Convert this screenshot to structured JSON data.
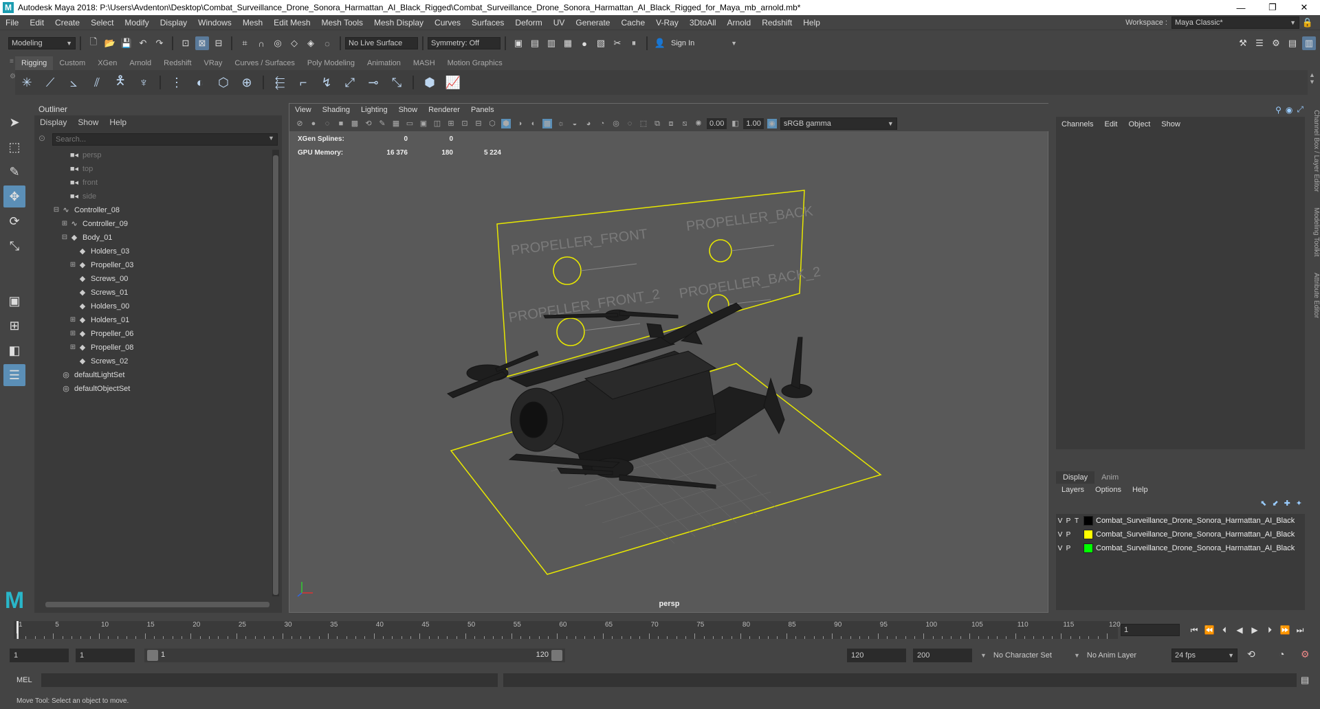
{
  "title_bar": {
    "title": "Autodesk Maya 2018: P:\\Users\\Avdenton\\Desktop\\Combat_Surveillance_Drone_Sonora_Harmattan_AI_Black_Rigged\\Combat_Surveillance_Drone_Sonora_Harmattan_AI_Black_Rigged_for_Maya_mb_arnold.mb*",
    "minimize": "—",
    "maximize": "❐",
    "close": "✕"
  },
  "menubar": {
    "items": [
      "File",
      "Edit",
      "Create",
      "Select",
      "Modify",
      "Display",
      "Windows",
      "Mesh",
      "Edit Mesh",
      "Mesh Tools",
      "Mesh Display",
      "Curves",
      "Surfaces",
      "Deform",
      "UV",
      "Generate",
      "Cache",
      "V-Ray",
      "3DtoAll",
      "Arnold",
      "Redshift",
      "Help"
    ],
    "workspace_label": "Workspace :",
    "workspace_value": "Maya Classic*"
  },
  "statusline": {
    "menuset": "Modeling",
    "live_surface": "No Live Surface",
    "symmetry": "Symmetry: Off",
    "sign_in": "Sign In"
  },
  "shelf": {
    "tabs": [
      "Rigging",
      "Custom",
      "XGen",
      "Arnold",
      "Redshift",
      "VRay",
      "Curves / Surfaces",
      "Poly Modeling",
      "Animation",
      "MASH",
      "Motion Graphics"
    ],
    "active_tab": "Rigging"
  },
  "outliner": {
    "title": "Outliner",
    "menu": [
      "Display",
      "Show",
      "Help"
    ],
    "search_placeholder": "Search...",
    "items": [
      {
        "label": "persp",
        "indent": 1,
        "icon": "camera-icon",
        "expand": "",
        "dim": true
      },
      {
        "label": "top",
        "indent": 1,
        "icon": "camera-icon",
        "expand": "",
        "dim": true
      },
      {
        "label": "front",
        "indent": 1,
        "icon": "camera-icon",
        "expand": "",
        "dim": true
      },
      {
        "label": "side",
        "indent": 1,
        "icon": "camera-icon",
        "expand": "",
        "dim": true
      },
      {
        "label": "Controller_08",
        "indent": 0,
        "icon": "curve-icon",
        "expand": "⊟",
        "dim": false
      },
      {
        "label": "Controller_09",
        "indent": 1,
        "icon": "curve-icon",
        "expand": "⊞",
        "dim": false
      },
      {
        "label": "Body_01",
        "indent": 1,
        "icon": "transform-icon",
        "expand": "⊟",
        "dim": false
      },
      {
        "label": "Holders_03",
        "indent": 2,
        "icon": "transform-icon",
        "expand": "",
        "dim": false
      },
      {
        "label": "Propeller_03",
        "indent": 2,
        "icon": "transform-icon",
        "expand": "⊞",
        "dim": false
      },
      {
        "label": "Screws_00",
        "indent": 2,
        "icon": "transform-icon",
        "expand": "",
        "dim": false
      },
      {
        "label": "Screws_01",
        "indent": 2,
        "icon": "transform-icon",
        "expand": "",
        "dim": false
      },
      {
        "label": "Holders_00",
        "indent": 2,
        "icon": "transform-icon",
        "expand": "",
        "dim": false
      },
      {
        "label": "Holders_01",
        "indent": 2,
        "icon": "transform-icon",
        "expand": "⊞",
        "dim": false
      },
      {
        "label": "Propeller_06",
        "indent": 2,
        "icon": "transform-icon",
        "expand": "⊞",
        "dim": false
      },
      {
        "label": "Propeller_08",
        "indent": 2,
        "icon": "transform-icon",
        "expand": "⊞",
        "dim": false
      },
      {
        "label": "Screws_02",
        "indent": 2,
        "icon": "transform-icon",
        "expand": "",
        "dim": false
      },
      {
        "label": "defaultLightSet",
        "indent": 0,
        "icon": "set-icon",
        "expand": "",
        "dim": false
      },
      {
        "label": "defaultObjectSet",
        "indent": 0,
        "icon": "set-icon",
        "expand": "",
        "dim": false
      }
    ]
  },
  "viewport": {
    "menu": [
      "View",
      "Shading",
      "Lighting",
      "Show",
      "Renderer",
      "Panels"
    ],
    "exposure": "0.00",
    "gamma": "1.00",
    "color_space": "sRGB gamma",
    "hud": [
      {
        "label": "XGen Splines:",
        "v1": "0",
        "v2": "0",
        "v3": ""
      },
      {
        "label": "GPU Memory:",
        "v1": "16 376",
        "v2": "180",
        "v3": "5 224"
      }
    ],
    "camera": "persp",
    "panel_labels": {
      "front": "PROPELLER_FRONT",
      "back": "PROPELLER_BACK",
      "front2": "PROPELLER_FRONT_2",
      "back2": "PROPELLER_BACK_2"
    }
  },
  "channel_box": {
    "menu": [
      "Channels",
      "Edit",
      "Object",
      "Show"
    ],
    "side_tabs": [
      "Channel Box / Layer Editor",
      "Modeling Toolkit",
      "Attribute Editor"
    ]
  },
  "layer_editor": {
    "tabs": [
      "Display",
      "Anim"
    ],
    "menu": [
      "Layers",
      "Options",
      "Help"
    ],
    "layers": [
      {
        "v": "V",
        "p": "P",
        "t": "T",
        "color": "#000000",
        "name": "Combat_Surveillance_Drone_Sonora_Harmattan_AI_Black"
      },
      {
        "v": "V",
        "p": "P",
        "t": "",
        "color": "#ffff00",
        "name": "Combat_Surveillance_Drone_Sonora_Harmattan_AI_Black"
      },
      {
        "v": "V",
        "p": "P",
        "t": "",
        "color": "#00ff00",
        "name": "Combat_Surveillance_Drone_Sonora_Harmattan_AI_Black"
      }
    ]
  },
  "timeline": {
    "ticks": [
      "1",
      "5",
      "10",
      "15",
      "20",
      "25",
      "30",
      "35",
      "40",
      "45",
      "50",
      "55",
      "60",
      "65",
      "70",
      "75",
      "80",
      "85",
      "90",
      "95",
      "100",
      "105",
      "110",
      "115",
      "120"
    ],
    "current_frame": "1"
  },
  "range": {
    "start": "1",
    "playback_start": "1",
    "slider_start": "1",
    "slider_end": "120",
    "playback_end": "120",
    "end": "200",
    "character_set": "No Character Set",
    "anim_layer": "No Anim Layer",
    "fps": "24 fps"
  },
  "command_line": {
    "label": "MEL"
  },
  "help_line": {
    "text": "Move Tool: Select an object to move."
  }
}
